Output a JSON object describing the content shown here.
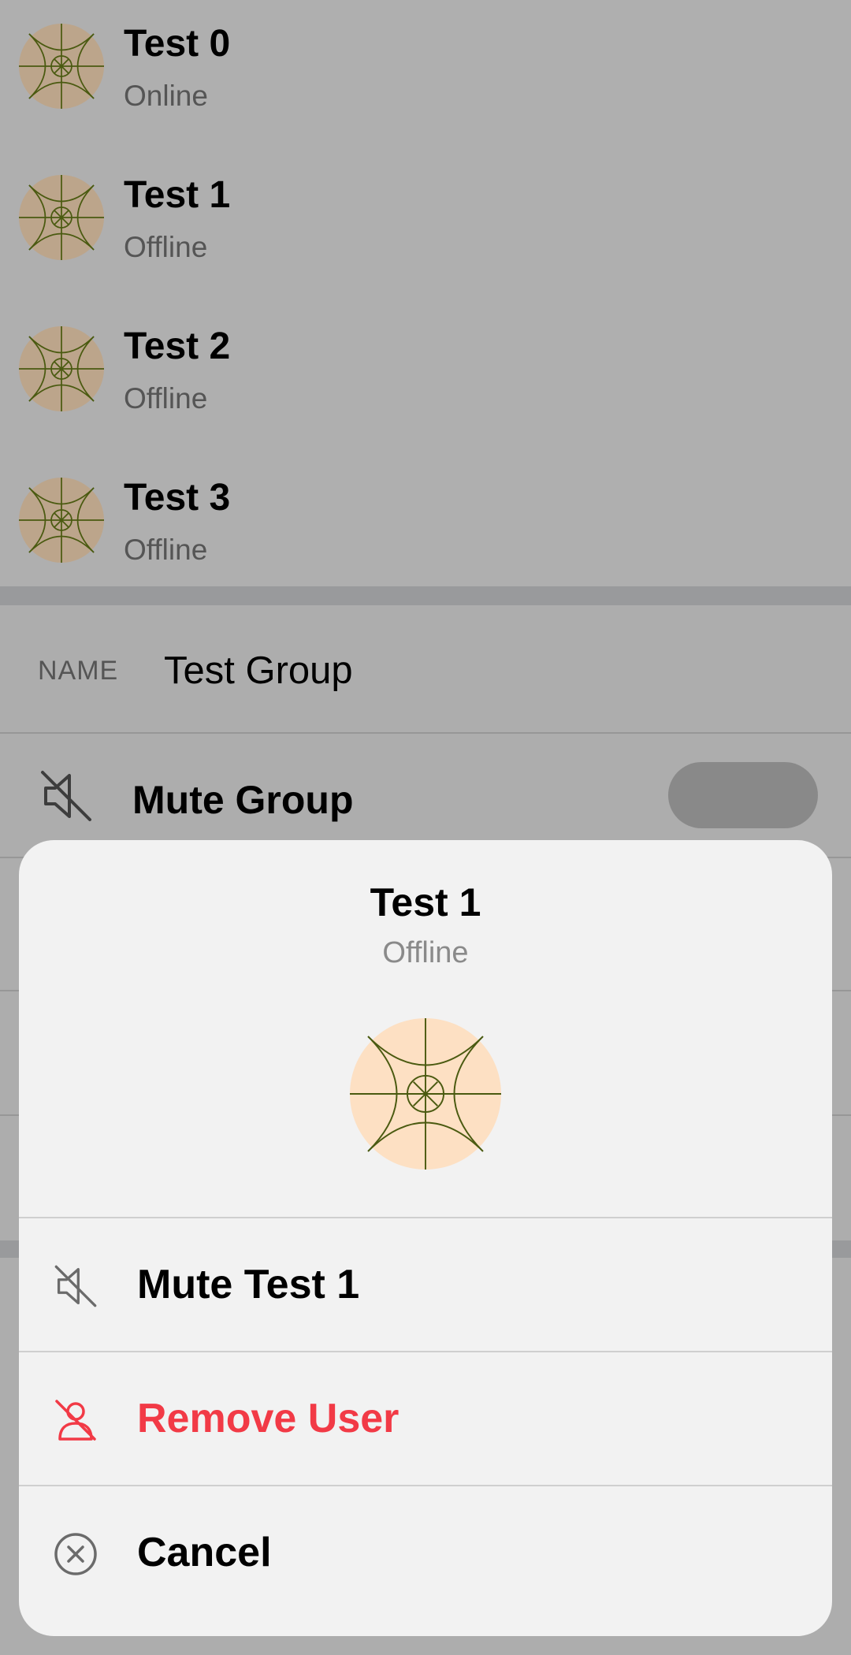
{
  "members": [
    {
      "name": "Test 0",
      "status": "Online"
    },
    {
      "name": "Test 1",
      "status": "Offline"
    },
    {
      "name": "Test 2",
      "status": "Offline"
    },
    {
      "name": "Test 3",
      "status": "Offline"
    }
  ],
  "settings": {
    "name_label": "NAME",
    "name_value": "Test Group",
    "mute_group_label": "Mute Group",
    "mute_group_icon": "speaker-muted-icon"
  },
  "sheet": {
    "title": "Test 1",
    "status": "Offline",
    "actions": [
      {
        "label": "Mute Test 1",
        "icon": "speaker-muted-icon"
      },
      {
        "label": "Remove User",
        "icon": "remove-user-icon",
        "color": "#f23a46"
      },
      {
        "label": "Cancel",
        "icon": "close-circle-icon"
      }
    ]
  },
  "colors": {
    "avatar_dimmed": "#bca58b",
    "avatar_fill": "#fde0c3",
    "avatar_lines": "#4a5a10",
    "danger": "#f23a46"
  }
}
